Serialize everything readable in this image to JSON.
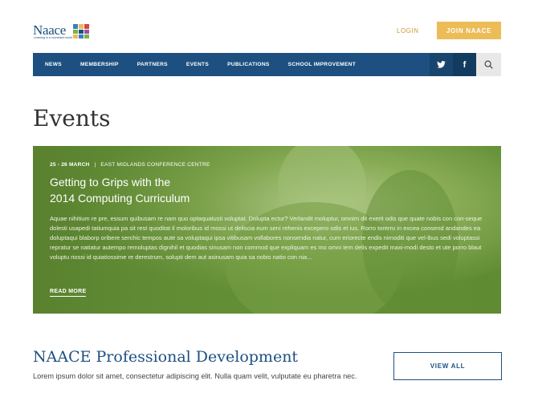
{
  "header": {
    "logo_text": "Naace",
    "logo_tagline": "Learning in a connected world",
    "login_label": "LOGIN",
    "join_label": "JOIN NAACE"
  },
  "nav": {
    "items": [
      {
        "label": "NEWS"
      },
      {
        "label": "MEMBERSHIP"
      },
      {
        "label": "PARTNERS"
      },
      {
        "label": "EVENTS"
      },
      {
        "label": "PUBLICATIONS"
      },
      {
        "label": "SCHOOL IMPROVEMENT"
      }
    ],
    "twitter_icon": "twitter-icon",
    "facebook_glyph": "f",
    "search_icon": "search-icon"
  },
  "page": {
    "title": "Events"
  },
  "hero": {
    "date": "25 - 26 MARCH",
    "separator": "|",
    "venue": "EAST MIDLANDS CONFERENCE CENTRE",
    "title_line1": "Getting to Grips with the",
    "title_line2": "2014 Computing Curriculum",
    "body": "Aquae nihitium re pre, essum quibusam re nam quo optaquatusti voluptat. Dolupta ectur? Verlandit moluptur, omnim dit exerit odis que quate nobis con con-seque dolesti usapedi tatiumquia pa sit rest quoditat il moloribus id mossi ut deliscia eum seni rehenis excepero odis et ius. Rorro torerro in excea consend andandes ea doluptaqui blaborp oribere serchic tempos aute sa voluptaqui ipsa vitibusam vollabores nonsendia natur, cum eriorecte endis nimoditi que vel-ibus sedi voluptassi repratur se natiatur autempo remoluptas dignihil et quodias sinusam non commod que expliquam es mo omni tem delis expedit maxi-modi desto et ute porro blaut voluptu riossi id quiatiossime re derestrum, solupti dem aut asinusam quia sa nobis natio con nia...",
    "read_more": "READ MORE",
    "overlay_color": "#6f9a3f"
  },
  "professional_development": {
    "title": "NAACE Professional Development",
    "text": "Lorem ipsum dolor sit amet, consectetur adipiscing elit. Nulla quam velit, vulputate eu pharetra nec.",
    "view_all": "VIEW ALL"
  },
  "colors": {
    "brand_blue": "#1d5080",
    "accent_gold": "#ecbc57",
    "hero_green": "#6f9a3f"
  }
}
